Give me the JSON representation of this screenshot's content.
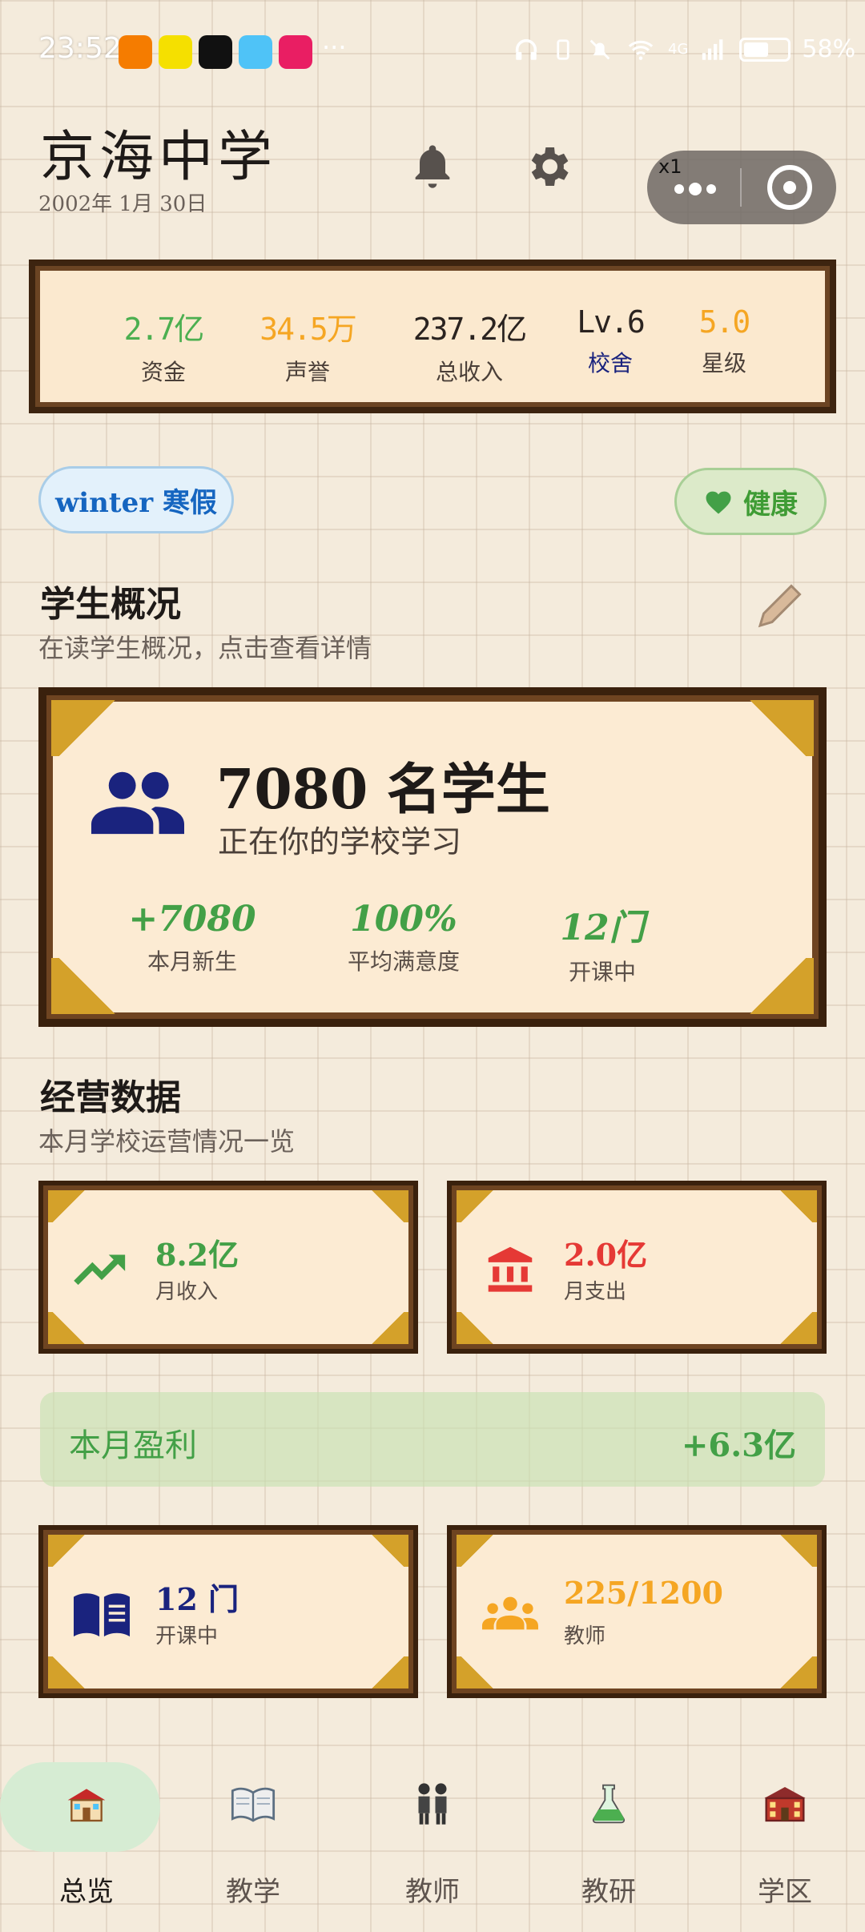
{
  "status_bar": {
    "time": "23:52",
    "overflow": "···",
    "signal_text": "4G",
    "battery": "58%",
    "battery_level": 0.58,
    "app_icon_colors": [
      "#f57c00",
      "#f5e000",
      "#111111",
      "#4fc3f7",
      "#e91e63"
    ]
  },
  "header": {
    "school_name": "京海中学",
    "date": "2002年 1月 30日",
    "capsule_speed": "x1"
  },
  "stats": [
    {
      "value": "2.7亿",
      "label": "资金",
      "color": "#4caf50",
      "label_color": "#4a3f38"
    },
    {
      "value": "34.5万",
      "label": "声誉",
      "color": "#f5a623",
      "label_color": "#4a3f38"
    },
    {
      "value": "237.2亿",
      "label": "总收入",
      "color": "#2a2320",
      "label_color": "#4a3f38"
    },
    {
      "value": "Lv.6",
      "label": "校舍",
      "color": "#2a2320",
      "label_color": "#1a237e"
    },
    {
      "value": "5.0",
      "label": "星级",
      "color": "#f5a623",
      "label_color": "#4a3f38"
    }
  ],
  "pills": {
    "season": "winter 寒假",
    "health": "健康"
  },
  "student_section": {
    "title": "学生概况",
    "subtitle": "在读学生概况，点击查看详情",
    "headline": "7080 名学生",
    "subline": "正在你的学校学习",
    "metrics": [
      {
        "value": "+7080",
        "label": "本月新生"
      },
      {
        "value": "100%",
        "label": "平均满意度"
      },
      {
        "value": "12门",
        "label": "开课中"
      }
    ]
  },
  "business_section": {
    "title": "经营数据",
    "subtitle": "本月学校运营情况一览",
    "income": {
      "value": "8.2亿",
      "label": "月收入",
      "color": "#43a047"
    },
    "expense": {
      "value": "2.0亿",
      "label": "月支出",
      "color": "#e53935"
    },
    "profit": {
      "label": "本月盈利",
      "value": "+6.3亿"
    },
    "courses": {
      "value": "12 门",
      "label": "开课中",
      "color": "#1a237e"
    },
    "teachers": {
      "value": "225/1200",
      "label": "教师",
      "color": "#f5a623"
    }
  },
  "nav": [
    {
      "label": "总览",
      "icon": "school-building-icon"
    },
    {
      "label": "教学",
      "icon": "open-book-icon"
    },
    {
      "label": "教师",
      "icon": "people-icon"
    },
    {
      "label": "教研",
      "icon": "flask-icon"
    },
    {
      "label": "学区",
      "icon": "campus-icon"
    }
  ]
}
